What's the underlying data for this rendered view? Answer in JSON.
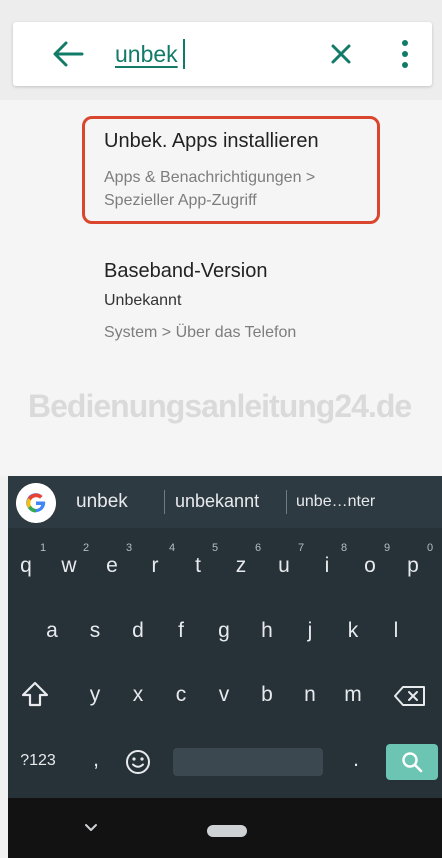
{
  "search": {
    "query": "unbek"
  },
  "results": [
    {
      "title": "Unbek. Apps installieren",
      "subtitle_line1": "Apps & Benachrichtigungen >",
      "subtitle_line2": "Spezieller App-Zugriff"
    },
    {
      "title": "Baseband-Version",
      "value": "Unbekannt",
      "subtitle": "System > Über das Telefon"
    }
  ],
  "watermark": "Bedienungsanleitung24.de",
  "keyboard": {
    "suggestions": [
      "unbek",
      "unbekannt",
      "unbe…nter"
    ],
    "row1": [
      "q",
      "w",
      "e",
      "r",
      "t",
      "z",
      "u",
      "i",
      "o",
      "p"
    ],
    "row1_hints": [
      "1",
      "2",
      "3",
      "4",
      "5",
      "6",
      "7",
      "8",
      "9",
      "0"
    ],
    "row2": [
      "a",
      "s",
      "d",
      "f",
      "g",
      "h",
      "j",
      "k",
      "l"
    ],
    "row3": [
      "y",
      "x",
      "c",
      "v",
      "b",
      "n",
      "m"
    ],
    "symbols_label": "?123",
    "comma": ",",
    "period": "."
  },
  "colors": {
    "accent": "#127b68",
    "highlight_border": "#d9462d",
    "keyboard_bg": "#263238",
    "search_key": "#6cc5b2"
  }
}
